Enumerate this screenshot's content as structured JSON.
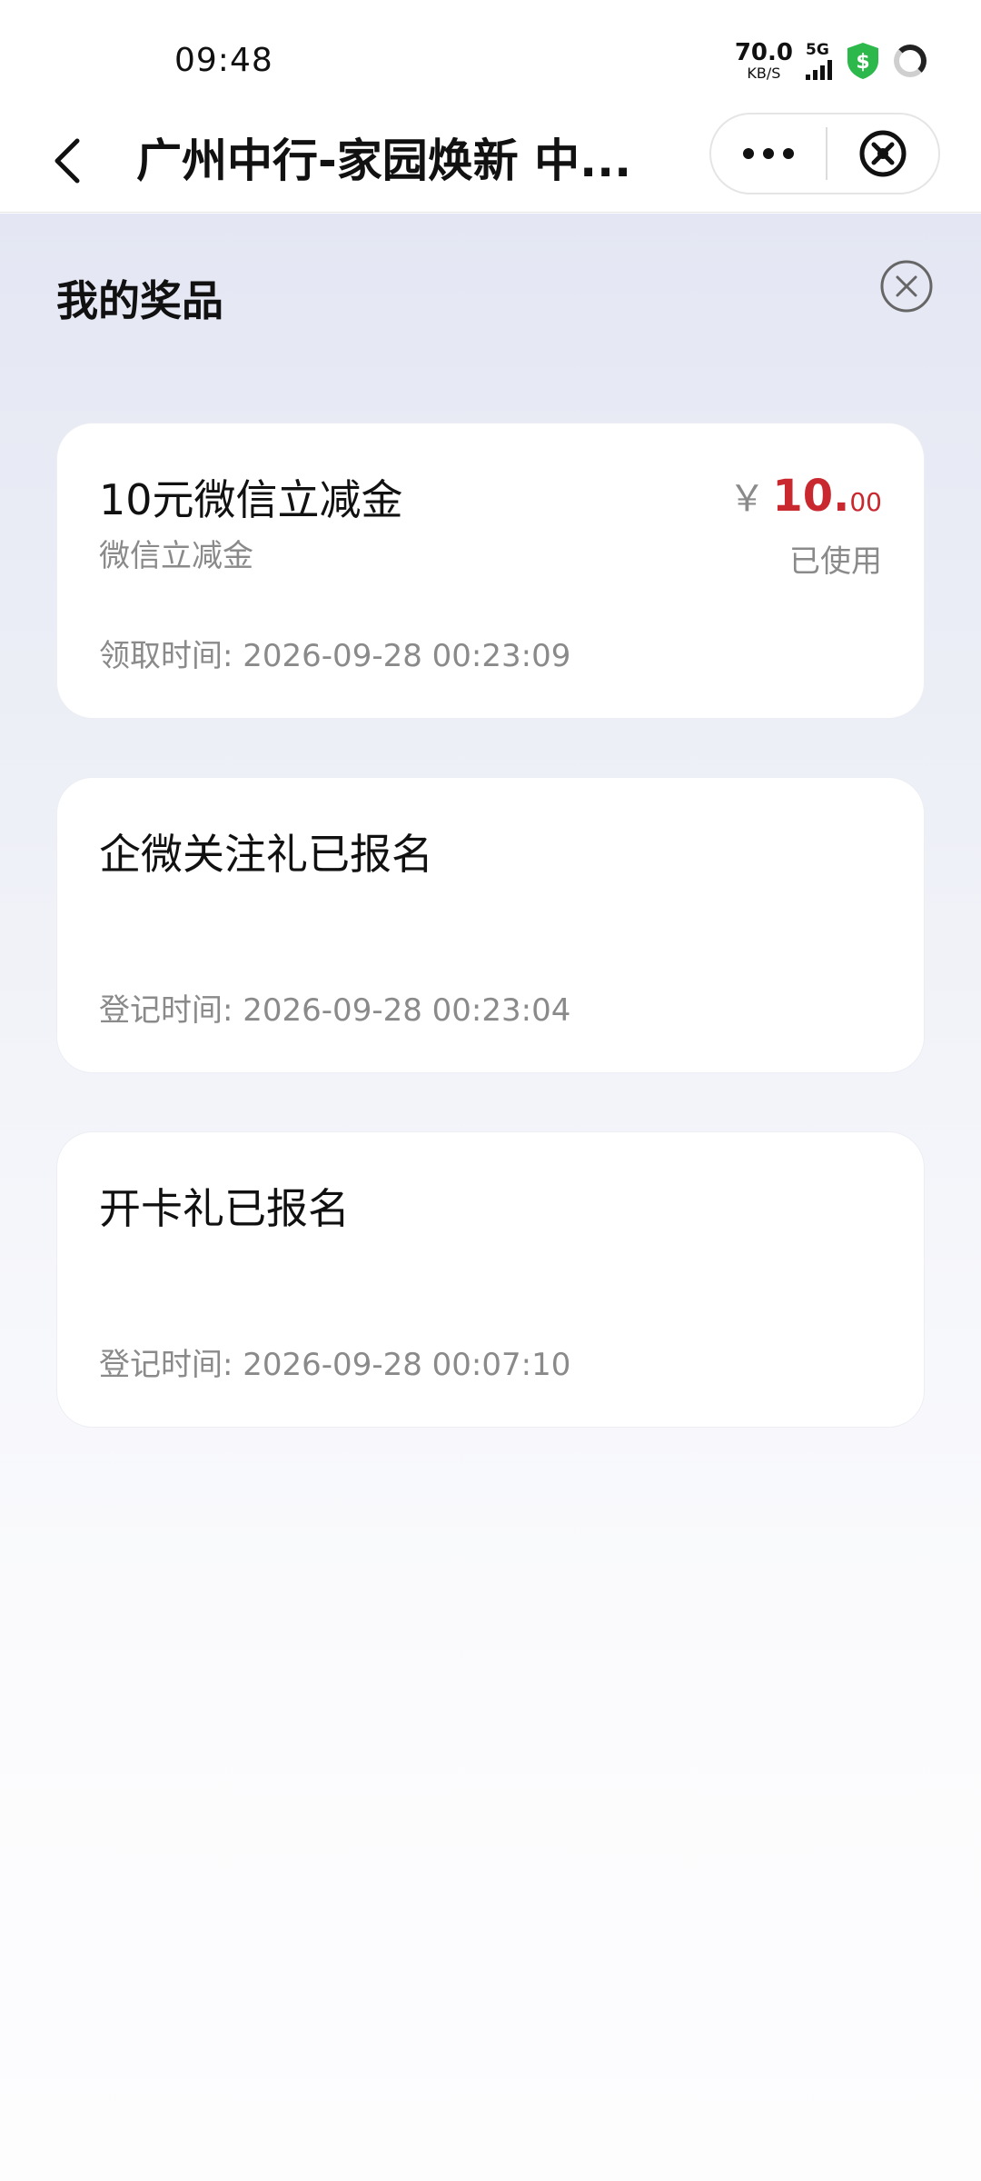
{
  "status_bar": {
    "time": "09:48",
    "net_speed_value": "70.0",
    "net_speed_unit": "KB/S",
    "network_type": "5G",
    "icons": [
      "signal-icon",
      "shield-dollar-icon",
      "loading-ring-icon"
    ]
  },
  "nav": {
    "title": "广州中行-家园焕新 中...",
    "icons": [
      "back-arrow-icon",
      "more-dots-icon",
      "close-circle-icon"
    ]
  },
  "page": {
    "title": "我的奖品"
  },
  "prizes": [
    {
      "name": "10元微信立减金",
      "subtitle": "微信立减金",
      "time": "领取时间: 2026-09-28 00:23:09",
      "currency": "￥",
      "amount_int": "10.",
      "amount_dec": "00",
      "status": "已使用"
    },
    {
      "name": "企微关注礼已报名",
      "time": "登记时间: 2026-09-28 00:23:04"
    },
    {
      "name": "开卡礼已报名",
      "time": "登记时间: 2026-09-28 00:07:10"
    }
  ],
  "colors": {
    "accent_price": "#c8282e",
    "shield": "#2db84b",
    "muted_text": "#8a8a8a"
  }
}
